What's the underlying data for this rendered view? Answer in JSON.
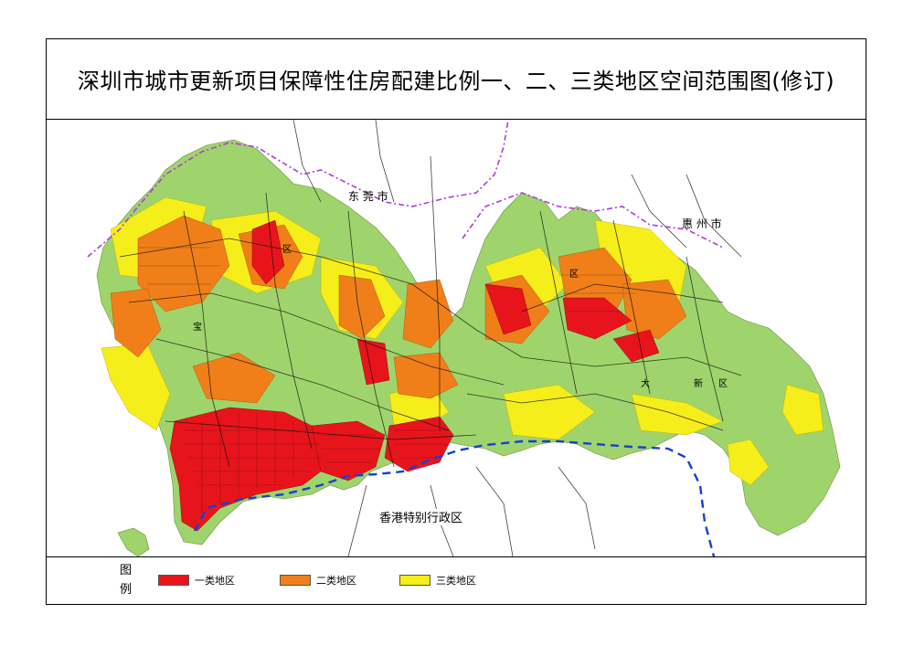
{
  "title": "深圳市城市更新项目保障性住房配建比例一、二、三类地区空间范围图(修订)",
  "map_labels": {
    "dongguan": "东 莞 市",
    "huizhou": "惠 州 市",
    "hongkong": "香港特别行政区",
    "district_qu_1": "区",
    "district_qu_2": "区",
    "district_bao": "宝",
    "district_da": "大",
    "district_xin": "新",
    "district_qu_3": "区"
  },
  "legend": {
    "heading_1": "图",
    "heading_2": "例",
    "items": [
      {
        "label": "一类地区",
        "color": "#e8141c"
      },
      {
        "label": "二类地区",
        "color": "#f07f1a"
      },
      {
        "label": "三类地区",
        "color": "#f5ee1a"
      }
    ]
  },
  "colors": {
    "land_green": "#9fd46c",
    "category_1_red": "#e8141c",
    "category_2_orange": "#f07f1a",
    "category_3_yellow": "#f5ee1a",
    "road_black": "#111111",
    "sea_boundary_blue": "#1440d8",
    "admin_boundary_purple": "#b23ad6"
  }
}
